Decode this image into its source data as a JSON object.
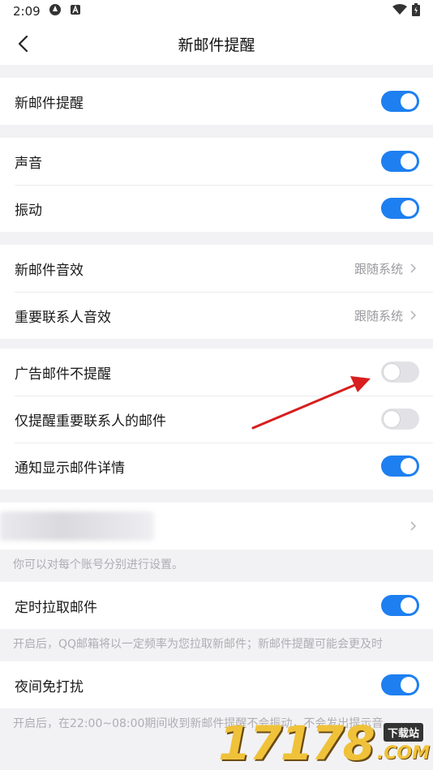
{
  "status_bar": {
    "time": "2:09"
  },
  "nav": {
    "title": "新邮件提醒"
  },
  "groups": {
    "g1": {
      "new_mail_label": "新邮件提醒"
    },
    "g2": {
      "sound_label": "声音",
      "vibrate_label": "振动"
    },
    "g3": {
      "new_mail_sound_label": "新邮件音效",
      "new_mail_sound_value": "跟随系统",
      "vip_sound_label": "重要联系人音效",
      "vip_sound_value": "跟随系统"
    },
    "g4": {
      "ad_mail_label": "广告邮件不提醒",
      "vip_only_label": "仅提醒重要联系人的邮件",
      "show_detail_label": "通知显示邮件详情"
    },
    "account_hint": "你可以对每个账号分别进行设置。",
    "g5": {
      "scheduled_fetch_label": "定时拉取邮件",
      "scheduled_fetch_hint": "开启后，QQ邮箱将以一定频率为您拉取新邮件；新邮件提醒可能会更及时"
    },
    "g6": {
      "night_label": "夜间免打扰",
      "night_hint": "开启后，在22:00~08:00期间收到新邮件提醒不会振动，不会发出提示音。"
    }
  },
  "toggles": {
    "new_mail": true,
    "sound": true,
    "vibrate": true,
    "ad_mail": false,
    "vip_only": false,
    "show_detail": true,
    "scheduled_fetch": true,
    "night": true
  },
  "watermark": {
    "digits": "17178",
    "badge": "下载站",
    "domain": ".COM"
  },
  "colors": {
    "accent": "#1e7ff0",
    "annotation_arrow": "#d81e1e"
  }
}
